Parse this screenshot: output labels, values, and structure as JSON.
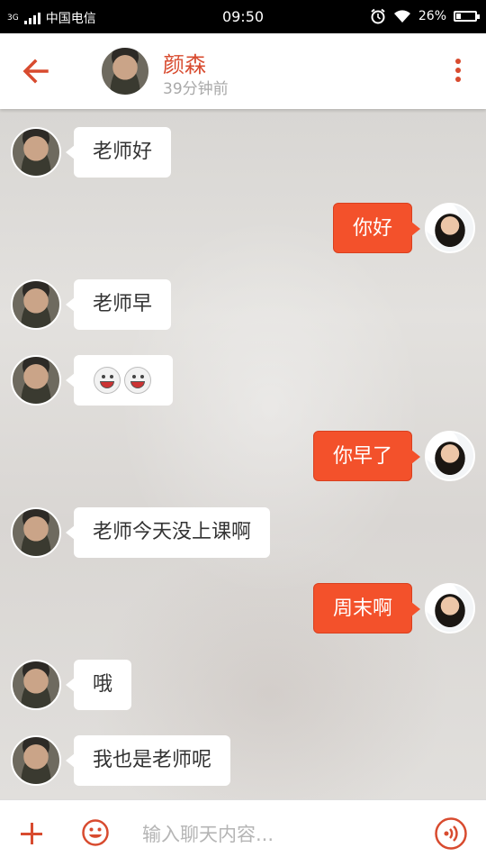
{
  "status_bar": {
    "network": "3G",
    "carrier": "中国电信",
    "time": "09:50",
    "battery": "26%",
    "battery_level": 0.26
  },
  "header": {
    "contact_name": "颜森",
    "contact_status": "39分钟前"
  },
  "messages": [
    {
      "side": "in",
      "text": "老师好"
    },
    {
      "side": "out",
      "text": "你好"
    },
    {
      "side": "in",
      "text": "老师早"
    },
    {
      "side": "in",
      "text": "",
      "emoji": [
        "grin-emoji",
        "grin-emoji"
      ]
    },
    {
      "side": "out",
      "text": "你早了"
    },
    {
      "side": "in",
      "text": "老师今天没上课啊"
    },
    {
      "side": "out",
      "text": "周末啊"
    },
    {
      "side": "in",
      "text": "哦"
    },
    {
      "side": "in",
      "text": "我也是老师呢"
    }
  ],
  "input_bar": {
    "placeholder": "输入聊天内容...",
    "value": ""
  },
  "colors": {
    "accent": "#d84b2f",
    "outgoing_bubble": "#f3512b",
    "incoming_bubble": "#ffffff"
  }
}
